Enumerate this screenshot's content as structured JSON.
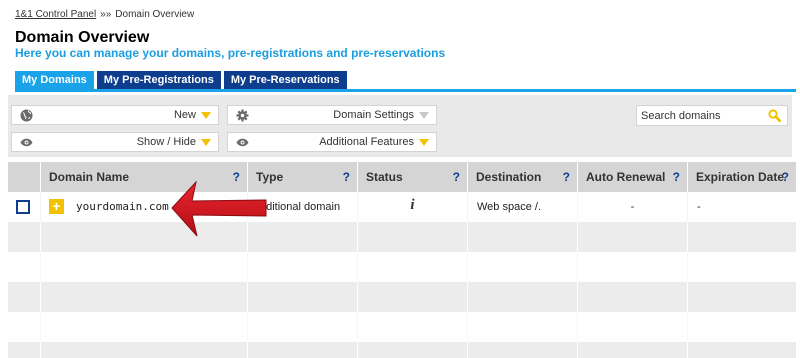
{
  "breadcrumb": {
    "root": "1&1 Control Panel",
    "separator": "»»",
    "current": "Domain Overview"
  },
  "page": {
    "title": "Domain Overview",
    "subtitle": "Here you can manage your domains, pre-registrations and pre-reservations"
  },
  "tabs": [
    {
      "label": "My Domains",
      "active": true
    },
    {
      "label": "My Pre-Registrations",
      "active": false
    },
    {
      "label": "My Pre-Reservations",
      "active": false
    }
  ],
  "toolbar": {
    "new_label": "New",
    "domain_settings_label": "Domain Settings",
    "show_hide_label": "Show / Hide",
    "additional_features_label": "Additional Features",
    "search_placeholder": "Search domains"
  },
  "table": {
    "columns": [
      {
        "label": "Domain Name",
        "help": "?"
      },
      {
        "label": "Type",
        "help": "?"
      },
      {
        "label": "Status",
        "help": "?"
      },
      {
        "label": "Destination",
        "help": "?"
      },
      {
        "label": "Auto Renewal",
        "help": "?"
      },
      {
        "label": "Expiration Date",
        "help": "?"
      }
    ],
    "rows": [
      {
        "expand": "+",
        "domain": "yourdomain.com",
        "type": "dditional domain",
        "status_icon": "info-icon",
        "status_glyph": "i",
        "destination": "Web space /.",
        "auto_renewal": "-",
        "expiration_date": "-"
      }
    ]
  },
  "colors": {
    "tab_active": "#1aa3e8",
    "tab_inactive": "#0d3d8c",
    "subtitle": "#1a9ee0",
    "caret": "#f2c200",
    "annotation_arrow": "#d6121e"
  }
}
